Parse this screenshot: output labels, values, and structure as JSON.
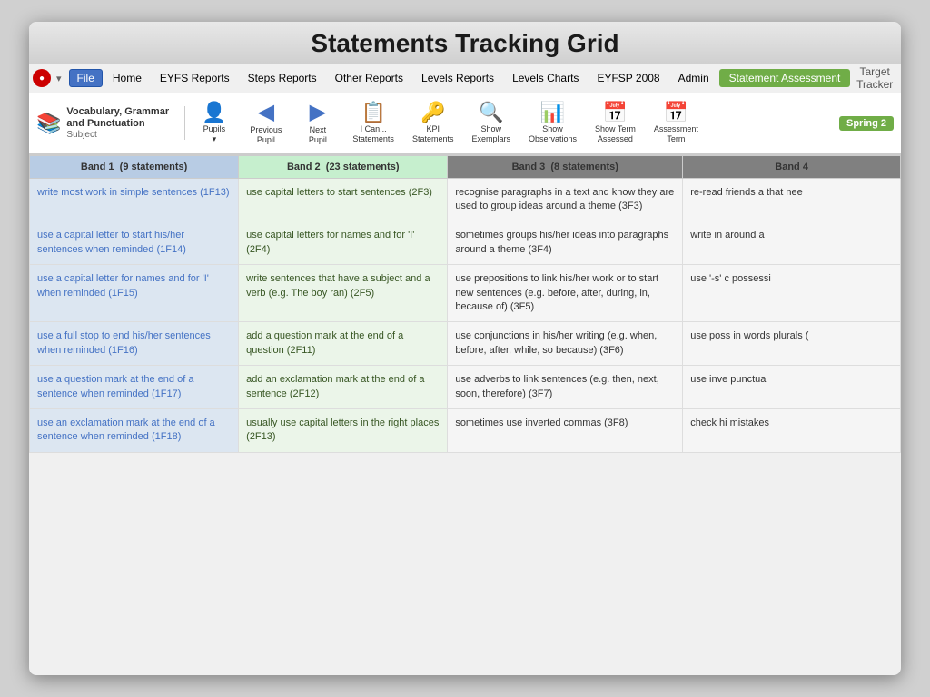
{
  "app": {
    "title": "Statements Tracking Grid",
    "menu_title": "Target Tracker"
  },
  "menubar": {
    "app_icon": "●",
    "menus": [
      {
        "id": "file",
        "label": "File",
        "active": true
      },
      {
        "id": "home",
        "label": "Home",
        "active": false
      },
      {
        "id": "eyfs",
        "label": "EYFS Reports",
        "active": false
      },
      {
        "id": "steps",
        "label": "Steps Reports",
        "active": false
      },
      {
        "id": "other",
        "label": "Other Reports",
        "active": false
      },
      {
        "id": "levels",
        "label": "Levels Reports",
        "active": false
      },
      {
        "id": "charts",
        "label": "Levels Charts",
        "active": false
      },
      {
        "id": "eyfsp",
        "label": "EYFSP 2008",
        "active": false
      },
      {
        "id": "admin",
        "label": "Admin",
        "active": false
      },
      {
        "id": "statement",
        "label": "Statement Assessment",
        "active": false,
        "highlighted": true
      }
    ]
  },
  "toolbar": {
    "subject_icon": "📚",
    "subject_label": "Vocabulary, Grammar and Punctuation",
    "subject_sublabel": "Subject",
    "buttons": [
      {
        "id": "pupils",
        "icon": "👤",
        "label": "Pupils\n▾"
      },
      {
        "id": "previous_pupil",
        "icon": "◀",
        "label": "Previous\nPupil"
      },
      {
        "id": "next_pupil",
        "icon": "▶",
        "label": "Next\nPupil"
      },
      {
        "id": "ican_statements",
        "icon": "📋",
        "label": "I Can...\nStatements"
      },
      {
        "id": "kpi_statements",
        "icon": "🔑",
        "label": "KPI\nStatements"
      },
      {
        "id": "show_exemplars",
        "icon": "🔍",
        "label": "Show\nExemplars"
      },
      {
        "id": "show_observations",
        "icon": "📊",
        "label": "Show\nObservations"
      },
      {
        "id": "show_term_assessed",
        "icon": "📅",
        "label": "Show Term\nAssessed"
      },
      {
        "id": "assessment_term",
        "icon": "📅",
        "label": "Assessment\nTerm"
      }
    ],
    "term": "Spring 2"
  },
  "grid": {
    "bands": [
      {
        "id": "band1",
        "label": "Band 1",
        "statements_count": "9 statements"
      },
      {
        "id": "band2",
        "label": "Band 2",
        "statements_count": "23 statements"
      },
      {
        "id": "band3",
        "label": "Band 3",
        "statements_count": "8 statements"
      },
      {
        "id": "band4",
        "label": "Band 4",
        "statements_count": ""
      }
    ],
    "rows": [
      {
        "band1": "write most work in simple sentences (1F13)",
        "band2": "use capital letters to start sentences (2F3)",
        "band3": "recognise paragraphs in a text and know they are used to group ideas around a theme (3F3)",
        "band4": "re-read friends a that nee"
      },
      {
        "band1": "use a capital letter to start his/her sentences when reminded (1F14)",
        "band2": "use capital letters for names and for 'I' (2F4)",
        "band3": "sometimes groups his/her ideas into paragraphs around a theme (3F4)",
        "band4": "write in around a"
      },
      {
        "band1": "use a capital letter for names and for 'I' when reminded (1F15)",
        "band2": "write sentences that have a subject and a verb (e.g. The boy ran) (2F5)",
        "band3": "use prepositions to link his/her work or to start new sentences (e.g. before, after, during, in, because of) (3F5)",
        "band4": "use '-s' c possessi"
      },
      {
        "band1": "use a full stop to end his/her sentences when reminded (1F16)",
        "band2": "add a question mark at the end of a question (2F11)",
        "band3": "use conjunctions in his/her writing (e.g. when, before, after, while, so because) (3F6)",
        "band4": "use poss in words plurals ("
      },
      {
        "band1": "use a question mark at the end of a sentence when reminded (1F17)",
        "band2": "add an exclamation mark at the end of a sentence (2F12)",
        "band3": "use adverbs to link sentences (e.g. then, next, soon, therefore) (3F7)",
        "band4": "use inve punctua"
      },
      {
        "band1": "use an exclamation mark at the end of a sentence when reminded (1F18)",
        "band2": "usually use capital letters in the right places (2F13)",
        "band3": "sometimes use inverted commas (3F8)",
        "band4": "check hi mistakes"
      }
    ]
  }
}
